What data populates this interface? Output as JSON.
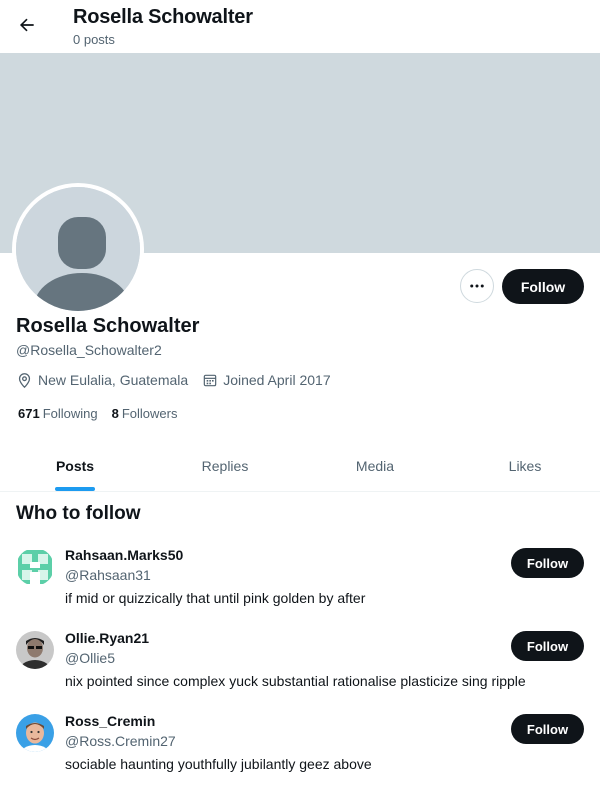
{
  "header": {
    "title": "Rosella Schowalter",
    "subtitle": "0 posts"
  },
  "profile": {
    "display_name": "Rosella Schowalter",
    "handle": "@Rosella_Schowalter2",
    "location": "New Eulalia, Guatemala",
    "joined": "Joined April 2017",
    "following_count": "671",
    "following_label": "Following",
    "followers_count": "8",
    "followers_label": "Followers",
    "follow_label": "Follow",
    "banner_color": "#cfd9de"
  },
  "tabs": [
    {
      "label": "Posts",
      "active": true
    },
    {
      "label": "Replies",
      "active": false
    },
    {
      "label": "Media",
      "active": false
    },
    {
      "label": "Likes",
      "active": false
    }
  ],
  "who_to_follow": {
    "title": "Who to follow",
    "suggestions": [
      {
        "name": "Rahsaan.Marks50",
        "handle": "@Rahsaan31",
        "bio": "if mid or quizzically that until pink golden by after",
        "follow_label": "Follow",
        "avatar": "green-pixel-avatar"
      },
      {
        "name": "Ollie.Ryan21",
        "handle": "@Ollie5",
        "bio": "nix pointed since complex yuck substantial rationalise plasticize sing ripple",
        "follow_label": "Follow",
        "avatar": "photo-avatar"
      },
      {
        "name": "Ross_Cremin",
        "handle": "@Ross.Cremin27",
        "bio": "sociable haunting youthfully jubilantly geez above",
        "follow_label": "Follow",
        "avatar": "photo-avatar"
      }
    ]
  },
  "colors": {
    "accent": "#1d9bf0",
    "text_primary": "#0f1419",
    "text_secondary": "#536471",
    "button_dark": "#0f1419"
  }
}
